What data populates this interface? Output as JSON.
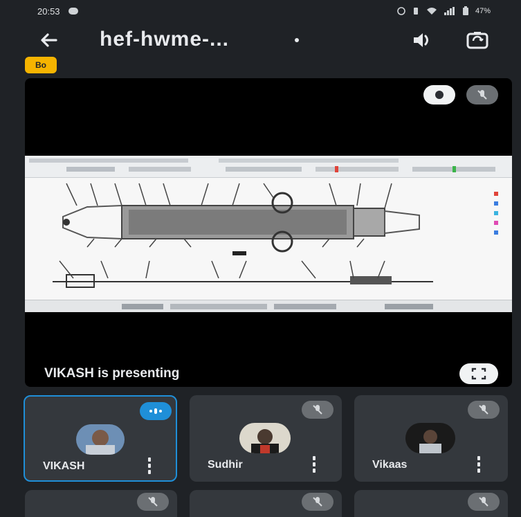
{
  "status_bar": {
    "time": "20:53",
    "battery": "47%"
  },
  "header": {
    "back_icon": "arrow-left-icon",
    "title": "hef-hwme-...",
    "speaker_icon": "speaker-icon",
    "camera_icon": "flip-camera-icon"
  },
  "badge": {
    "label": "Bo"
  },
  "presentation": {
    "presenting_text": "VIKASH is presenting",
    "pin_icon": "pin-icon",
    "mute_icon": "mic-off-icon",
    "fullscreen_icon": "fullscreen-icon"
  },
  "participants": [
    {
      "name": "VIKASH",
      "speaking": true,
      "muted": false
    },
    {
      "name": "Sudhir",
      "speaking": false,
      "muted": true
    },
    {
      "name": "Vikaas",
      "speaking": false,
      "muted": true
    }
  ],
  "colors": {
    "background": "#1f2226",
    "tile": "#34383d",
    "accent": "#1f8fd8",
    "badge": "#f5b400"
  }
}
